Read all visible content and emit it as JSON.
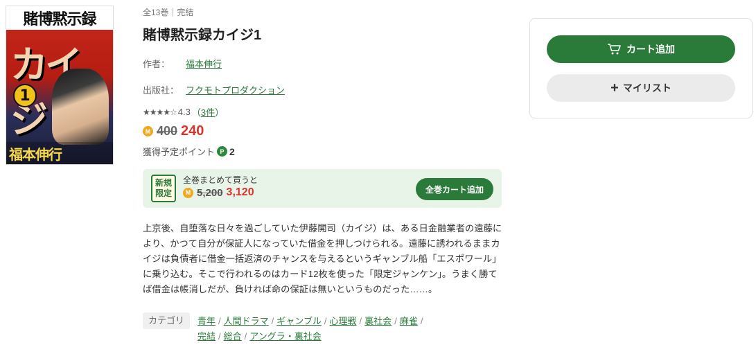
{
  "cover": {
    "title_text": "賭博黙示録",
    "series_text": "カイジ",
    "volume_text": "1",
    "author_text": "福本伸行"
  },
  "product": {
    "meta": "全13巻｜完結",
    "title": "賭博黙示録カイジ1",
    "author_label": "作者：",
    "author": "福本伸行",
    "publisher_label": "出版社：",
    "publisher": "フクモトプロダクション",
    "rating_stars": "★★★★☆",
    "rating_value": "4.3",
    "review_count": "3件",
    "coin_symbol": "M",
    "price_old": "400",
    "price_new": "240",
    "points_label": "獲得予定ポイント",
    "points_symbol": "P",
    "points_value": "2"
  },
  "bundle": {
    "badge_line1": "新規",
    "badge_line2": "限定",
    "caption": "全巻まとめて買うと",
    "price_old": "5,200",
    "price_new": "3,120",
    "button_label": "全巻カート追加"
  },
  "description": "上京後、自堕落な日々を過ごしていた伊藤開司（カイジ）は、ある日金融業者の遠藤により、かつて自分が保証人になっていた借金を押しつけられる。遠藤に誘われるままカイジは負債者に借金一括返済のチャンスを与えるというギャンブル船「エスポワール」に乗り込む。そこで行われるのはカード12枚を使った「限定ジャンケン」。うまく勝てば借金は帳消しだが、負ければ命の保証は無いというものだった……。",
  "categories": {
    "label": "カテゴリ",
    "items": [
      "青年",
      "人間ドラマ",
      "ギャンブル",
      "心理戦",
      "裏社会",
      "麻雀",
      "完結",
      "総合",
      "アングラ・裏社会"
    ]
  },
  "panel": {
    "cart_label": "カート追加",
    "mylist_label": "マイリスト"
  },
  "colors": {
    "brand_green": "#2a7a3a",
    "price_red": "#d9342a",
    "coin_orange": "#f0a81c"
  }
}
